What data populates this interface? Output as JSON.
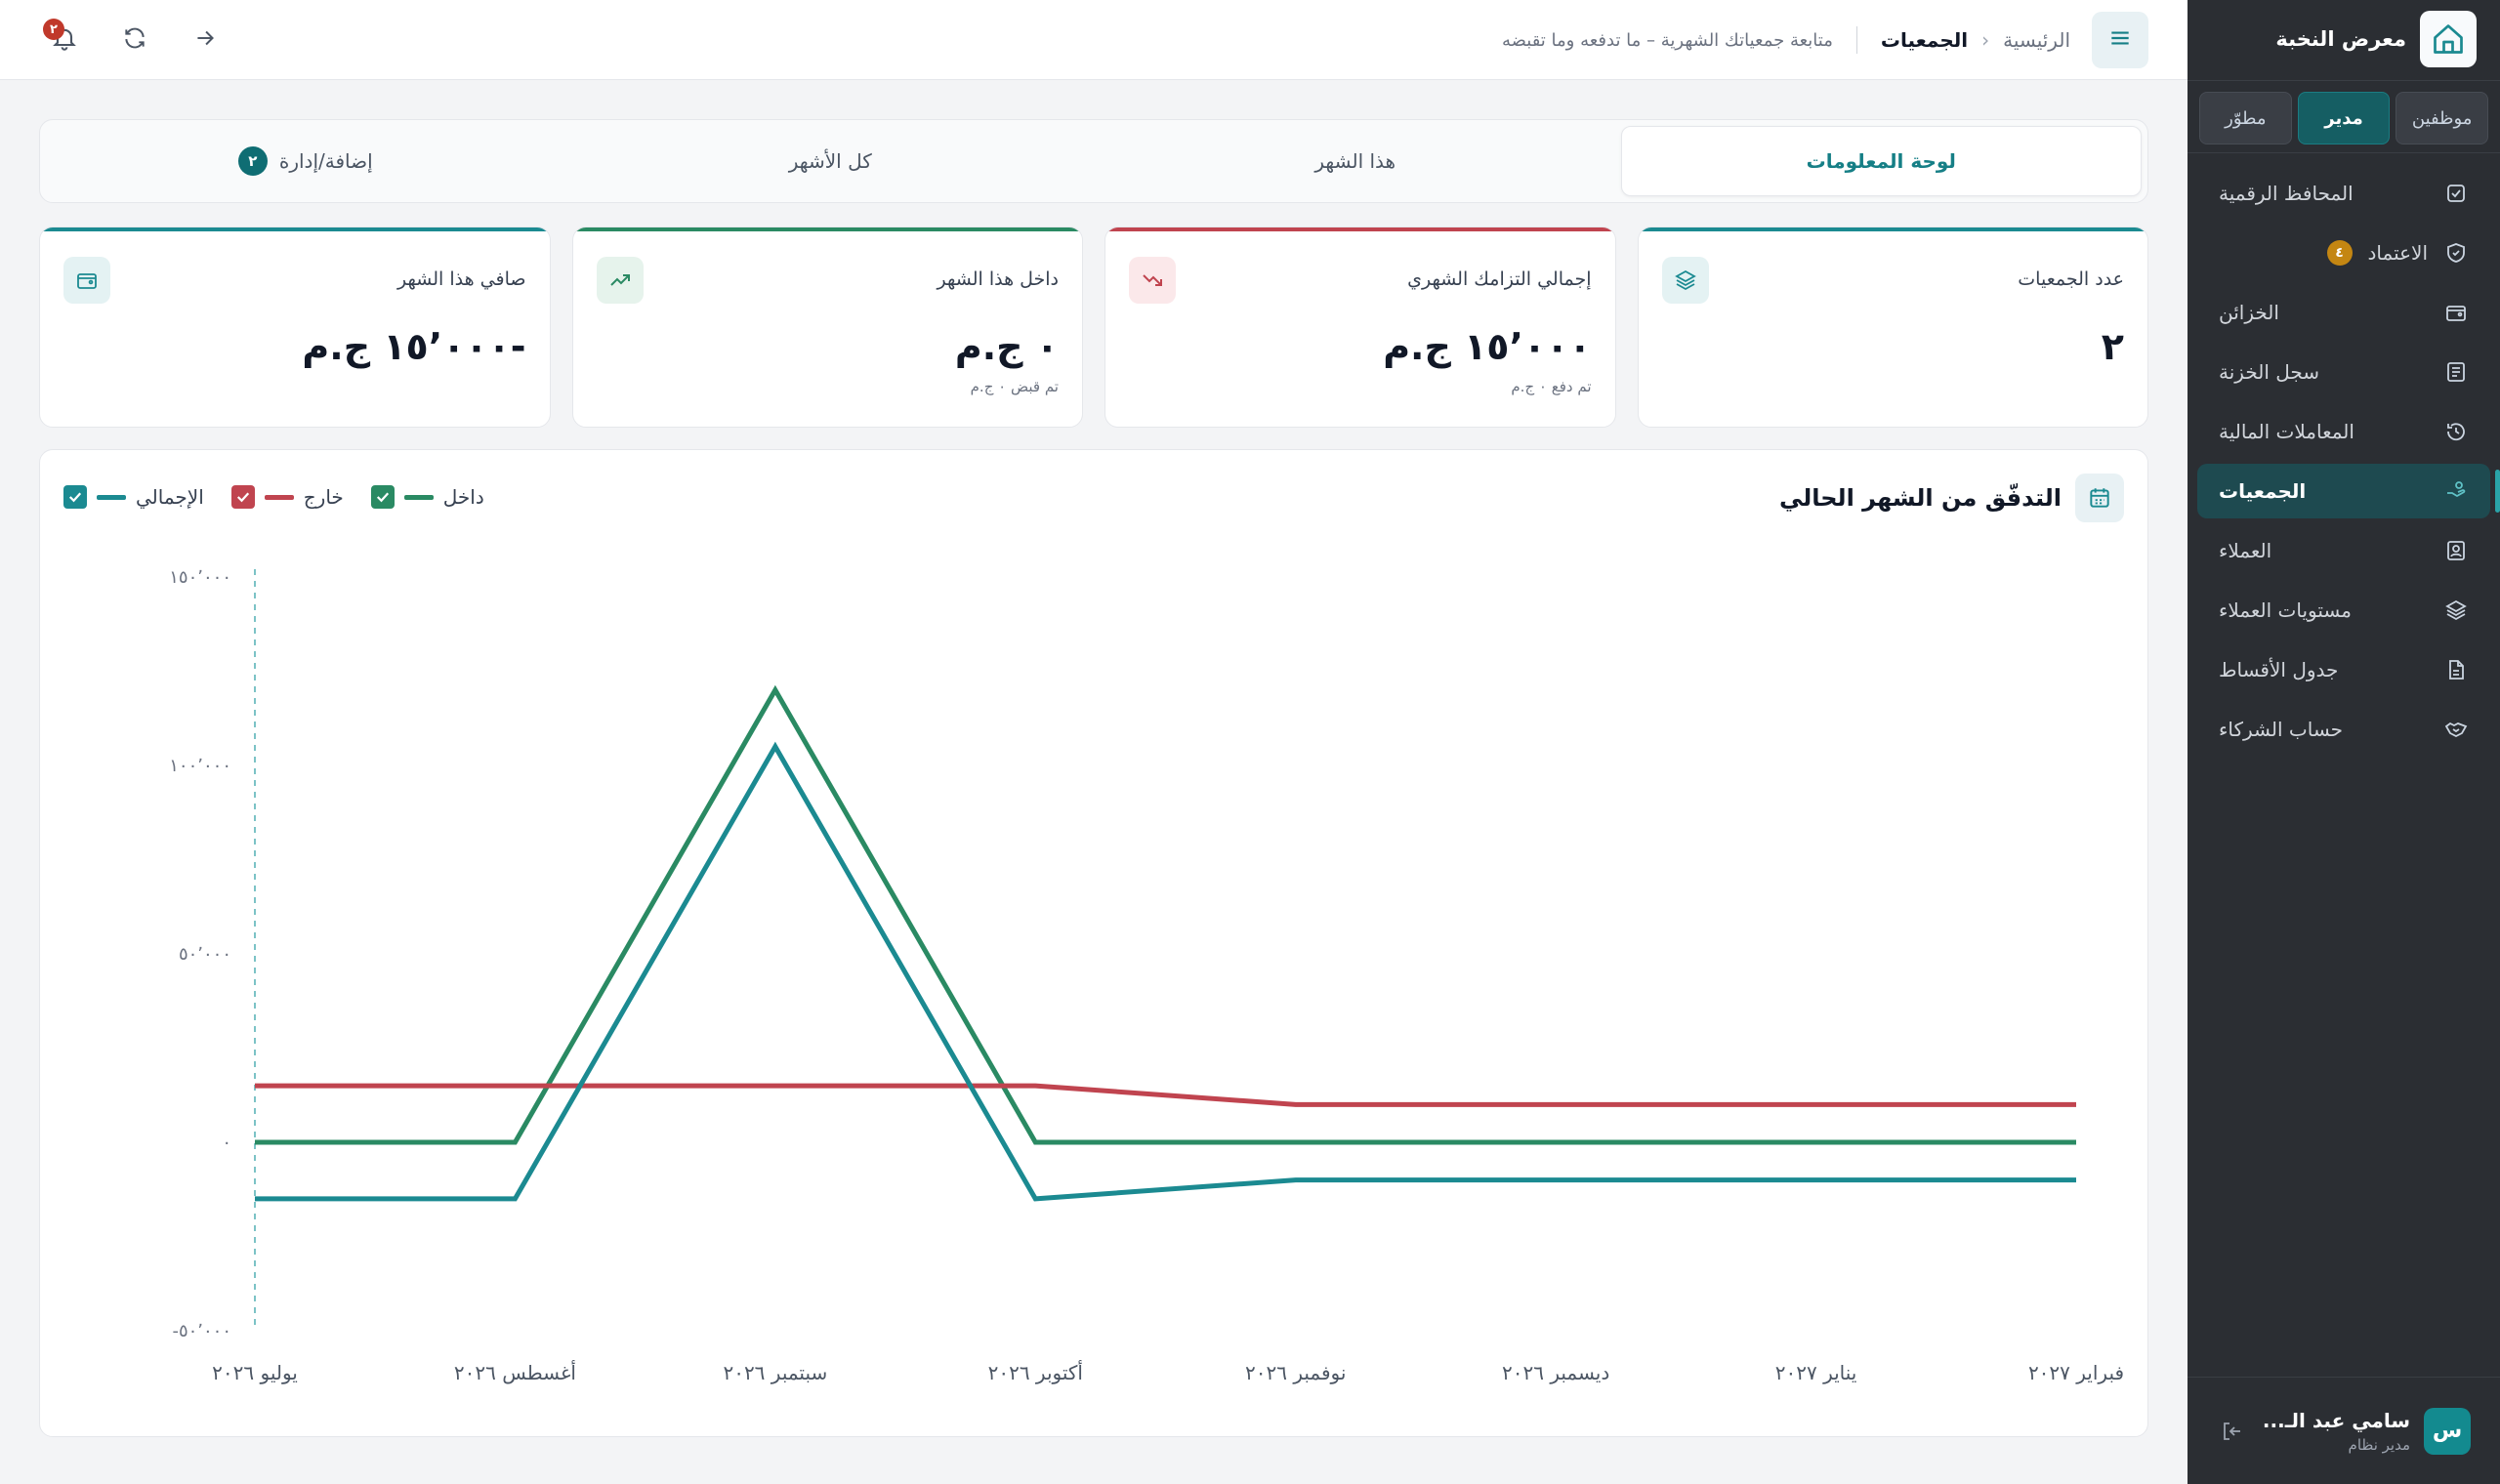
{
  "sidebar": {
    "brand": "معرض النخبة",
    "roles": [
      "موظفين",
      "مدير",
      "مطوّر"
    ],
    "active_role": "مدير",
    "items": [
      {
        "label": "المحافظ الرقمية",
        "icon": "checkbox-icon"
      },
      {
        "label": "الاعتماد",
        "icon": "shield-check-icon",
        "badge": "٤"
      },
      {
        "label": "الخزائن",
        "icon": "wallet-icon"
      },
      {
        "label": "سجل الخزنة",
        "icon": "ledger-icon"
      },
      {
        "label": "المعاملات المالية",
        "icon": "history-icon"
      },
      {
        "label": "الجمعيات",
        "icon": "hand-coins-icon",
        "active": true
      },
      {
        "label": "العملاء",
        "icon": "contact-icon"
      },
      {
        "label": "مستويات العملاء",
        "icon": "layers-icon"
      },
      {
        "label": "جدول الأقساط",
        "icon": "document-icon"
      },
      {
        "label": "حساب الشركاء",
        "icon": "handshake-icon"
      }
    ],
    "user": {
      "name": "سامي عبد الـ...",
      "role": "مدير نظام",
      "initial": "س"
    }
  },
  "header": {
    "home": "الرئيسية",
    "current": "الجمعيات",
    "description": "متابعة جمعياتك الشهرية – ما تدفعه وما تقبضه",
    "notifications": "٢"
  },
  "tabs": [
    {
      "label": "لوحة المعلومات",
      "active": true
    },
    {
      "label": "هذا الشهر"
    },
    {
      "label": "كل الأشهر"
    },
    {
      "label": "إضافة/إدارة",
      "badge": "٢"
    }
  ],
  "cards": [
    {
      "title": "عدد الجمعيات",
      "value": "٢",
      "sub": "",
      "accent": "#1b8a91",
      "icon": "layers-icon",
      "icon_bg": "#e4f2f3",
      "icon_color": "#1b8a91"
    },
    {
      "title": "إجمالي التزامك الشهري",
      "value": "١٥٬٠٠٠ ج.م",
      "sub": "تم دفع ٠ ج.م",
      "accent": "#c0444f",
      "icon": "trend-down-icon",
      "icon_bg": "#fbe8ea",
      "icon_color": "#c0444f"
    },
    {
      "title": "داخل هذا الشهر",
      "value": "٠ ج.م",
      "sub": "تم قبض ٠ ج.م",
      "accent": "#2a8a63",
      "icon": "trend-up-icon",
      "icon_bg": "#e6f3ec",
      "icon_color": "#2a8a63"
    },
    {
      "title": "صافي هذا الشهر",
      "value": "-١٥٬٠٠٠ ج.م",
      "sub": "",
      "accent": "#1b8a91",
      "icon": "wallet-icon",
      "icon_bg": "#e4f2f3",
      "icon_color": "#1b8a91"
    }
  ],
  "chart_panel": {
    "title": "التدفّق من الشهر الحالي",
    "legend": [
      {
        "label": "داخل",
        "color": "#2a8a63",
        "checked": true
      },
      {
        "label": "خارج",
        "color": "#c0444f",
        "checked": true
      },
      {
        "label": "الإجمالي",
        "color": "#1b8a91",
        "checked": true
      }
    ]
  },
  "chart_data": {
    "type": "line",
    "title": "التدفّق من الشهر الحالي",
    "categories": [
      "يوليو ٢٠٢٦",
      "أغسطس ٢٠٢٦",
      "سبتمبر ٢٠٢٦",
      "أكتوبر ٢٠٢٦",
      "نوفمبر ٢٠٢٦",
      "ديسمبر ٢٠٢٦",
      "يناير ٢٠٢٧",
      "فبراير ٢٠٢٧"
    ],
    "y_ticks": [
      {
        "value": 150000,
        "label": "١٥٠٬٠٠٠"
      },
      {
        "value": 100000,
        "label": "١٠٠٬٠٠٠"
      },
      {
        "value": 50000,
        "label": "٥٠٬٠٠٠"
      },
      {
        "value": 0,
        "label": "٠"
      },
      {
        "value": -50000,
        "label": "-٥٠٬٠٠٠"
      }
    ],
    "ylim": [
      -50000,
      150000
    ],
    "series": [
      {
        "name": "داخل",
        "color": "#2a8a63",
        "values": [
          0,
          0,
          120000,
          0,
          0,
          0,
          0,
          0
        ]
      },
      {
        "name": "خارج",
        "color": "#c0444f",
        "values": [
          15000,
          15000,
          15000,
          15000,
          10000,
          10000,
          10000,
          10000
        ]
      },
      {
        "name": "الإجمالي",
        "color": "#1b8a91",
        "values": [
          -15000,
          -15000,
          105000,
          -15000,
          -10000,
          -10000,
          -10000,
          -10000
        ]
      }
    ],
    "current_marker": "يوليو ٢٠٢٦",
    "grid": false,
    "legend_position": "top-left"
  }
}
